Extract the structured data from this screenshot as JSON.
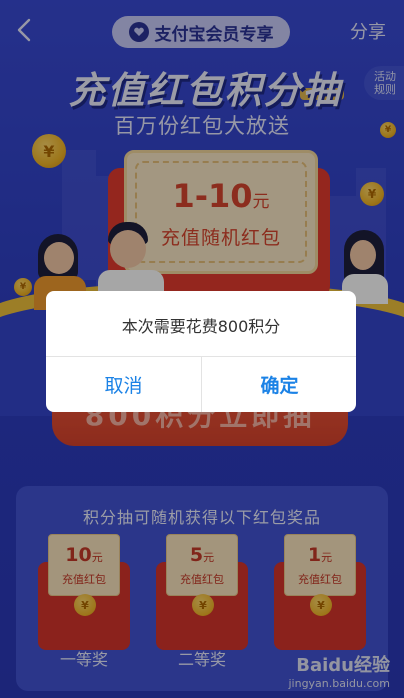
{
  "header": {
    "back_label": "<",
    "badge_text": "支付宝会员专享",
    "share_label": "分享"
  },
  "hero": {
    "title": "充值红包积分抽",
    "rules_label": "活动规则",
    "subtitle": "百万份红包大放送"
  },
  "prize_card": {
    "amount": "1-10",
    "unit": "元",
    "label": "充值随机红包"
  },
  "draw_button": {
    "label": "800积分立即抽"
  },
  "dialog": {
    "message": "本次需要花费800积分",
    "cancel_label": "取消",
    "confirm_label": "确定"
  },
  "prizes": {
    "heading": "积分抽可随机获得以下红包奖品",
    "items": [
      {
        "amount": "10",
        "unit": "元",
        "label": "充值红包",
        "tier": "一等奖"
      },
      {
        "amount": "5",
        "unit": "元",
        "label": "充值红包",
        "tier": "二等奖"
      },
      {
        "amount": "1",
        "unit": "元",
        "label": "充值红包",
        "tier": ""
      }
    ]
  },
  "coin_symbol": "¥",
  "watermark": {
    "brand": "Baidu经验",
    "url": "jingyan.baidu.com"
  },
  "colors": {
    "background": "#3142c8",
    "accent_red": "#d8452f",
    "dialog_button": "#1b82e6",
    "gold": "#f2b628"
  }
}
